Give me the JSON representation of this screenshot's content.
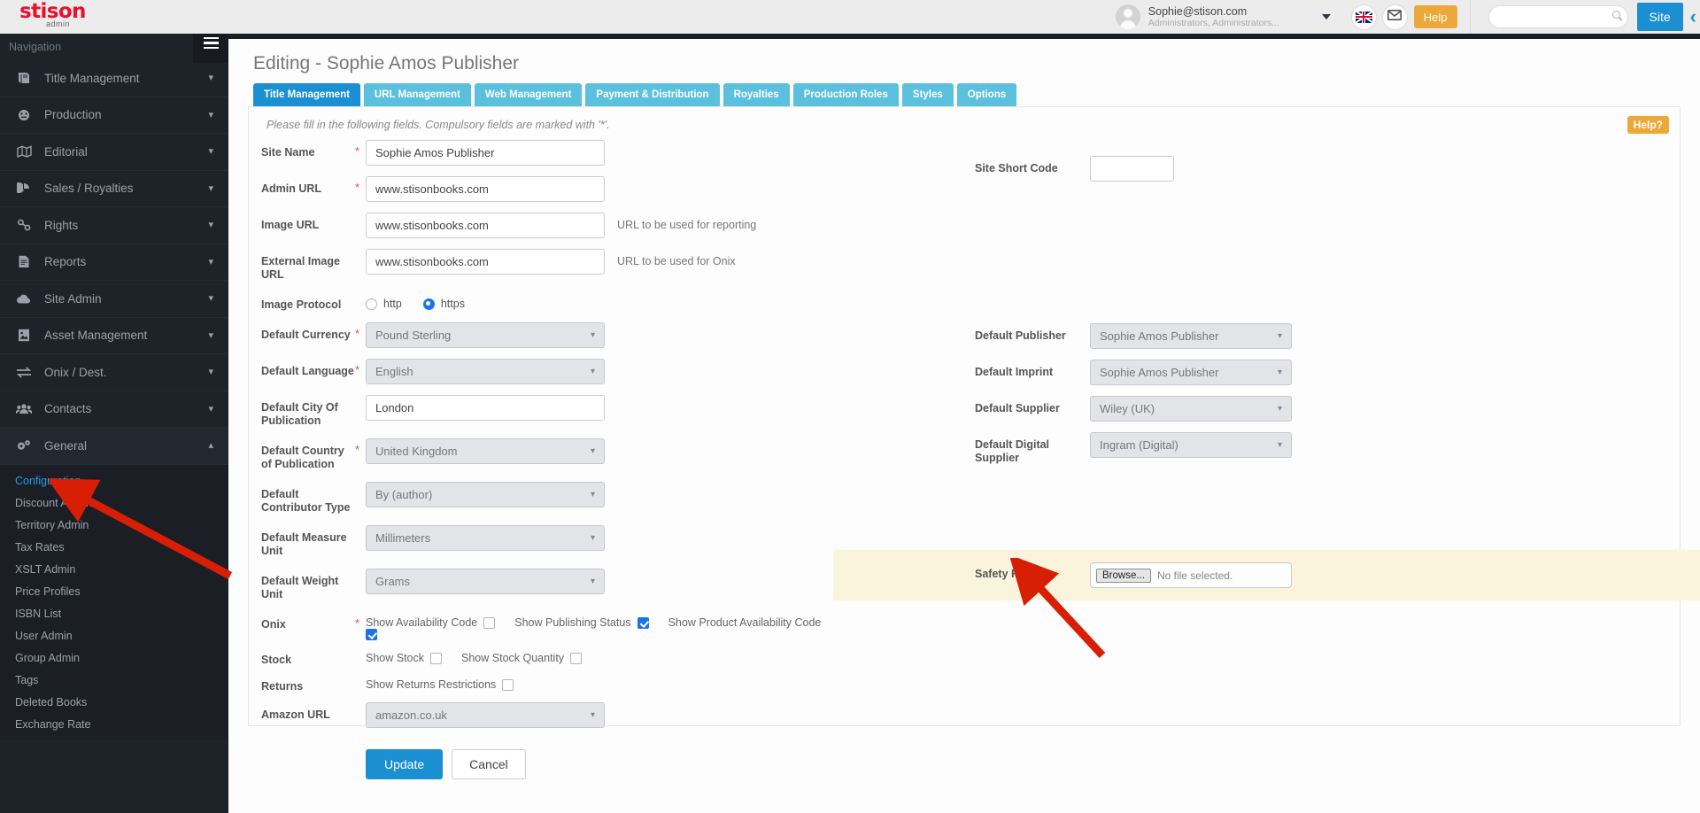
{
  "topbar": {
    "logo_main": "stison",
    "logo_sub": "admin",
    "user_email": "Sophie@stison.com",
    "user_role": "Administrators, Administrators...",
    "flag_icon": "uk-flag-icon",
    "mail_icon": "envelope-icon",
    "help_label": "Help",
    "search_value": "",
    "search_placeholder": "",
    "site_label": "Site",
    "collapse_icon": "chevron-left-icon",
    "accent_blue": "#1a8fd1",
    "accent_orange": "#eda83a",
    "logo_red": "#e8112d"
  },
  "sidebar": {
    "header_label": "Navigation",
    "burger_icon": "hamburger-icon",
    "items": [
      {
        "label": "Title Management",
        "icon": "book-icon",
        "chevron": "chevron-down-icon",
        "open": false
      },
      {
        "label": "Production",
        "icon": "gauge-icon",
        "chevron": "chevron-down-icon",
        "open": false
      },
      {
        "label": "Editorial",
        "icon": "map-icon",
        "chevron": "chevron-down-icon",
        "open": false
      },
      {
        "label": "Sales / Royalties",
        "icon": "pie-chart-icon",
        "chevron": "chevron-down-icon",
        "open": false
      },
      {
        "label": "Rights",
        "icon": "link-icon",
        "chevron": "chevron-down-icon",
        "open": false
      },
      {
        "label": "Reports",
        "icon": "document-icon",
        "chevron": "chevron-down-icon",
        "open": false
      },
      {
        "label": "Site Admin",
        "icon": "cloud-icon",
        "chevron": "chevron-down-icon",
        "open": false
      },
      {
        "label": "Asset Management",
        "icon": "image-file-icon",
        "chevron": "chevron-down-icon",
        "open": false
      },
      {
        "label": "Onix / Dest.",
        "icon": "exchange-icon",
        "chevron": "chevron-down-icon",
        "open": false
      },
      {
        "label": "Contacts",
        "icon": "users-icon",
        "chevron": "chevron-down-icon",
        "open": false
      },
      {
        "label": "General",
        "icon": "gears-icon",
        "chevron": "chevron-up-icon",
        "open": true
      }
    ],
    "sub_items": [
      {
        "label": "Configuration",
        "active": true
      },
      {
        "label": "Discount Admin",
        "active": false
      },
      {
        "label": "Territory Admin",
        "active": false
      },
      {
        "label": "Tax Rates",
        "active": false
      },
      {
        "label": "XSLT Admin",
        "active": false
      },
      {
        "label": "Price Profiles",
        "active": false
      },
      {
        "label": "ISBN List",
        "active": false
      },
      {
        "label": "User Admin",
        "active": false
      },
      {
        "label": "Group Admin",
        "active": false
      },
      {
        "label": "Tags",
        "active": false
      },
      {
        "label": "Deleted Books",
        "active": false
      },
      {
        "label": "Exchange Rate",
        "active": false
      }
    ]
  },
  "main": {
    "page_title": "Editing - Sophie Amos Publisher",
    "help_tag": "Help?",
    "hint": "Please fill in the following fields. Compulsory fields are marked with '*'.",
    "tabs": [
      {
        "label": "Title Management",
        "active": true
      },
      {
        "label": "URL Management",
        "active": false
      },
      {
        "label": "Web Management",
        "active": false
      },
      {
        "label": "Payment & Distribution",
        "active": false
      },
      {
        "label": "Royalties",
        "active": false
      },
      {
        "label": "Production Roles",
        "active": false
      },
      {
        "label": "Styles",
        "active": false
      },
      {
        "label": "Options",
        "active": false
      }
    ],
    "left_fields": {
      "site_name": {
        "label": "Site Name",
        "required": true,
        "value": "Sophie Amos Publisher"
      },
      "admin_url": {
        "label": "Admin URL",
        "required": true,
        "value": "www.stisonbooks.com"
      },
      "image_url": {
        "label": "Image URL",
        "required": false,
        "value": "www.stisonbooks.com",
        "helper": "URL to be used for reporting"
      },
      "external_image_url": {
        "label": "External Image URL",
        "required": false,
        "value": "www.stisonbooks.com",
        "helper": "URL to be used for Onix"
      },
      "image_protocol": {
        "label": "Image Protocol",
        "options": [
          {
            "label": "http",
            "selected": false
          },
          {
            "label": "https",
            "selected": true
          }
        ]
      },
      "default_currency": {
        "label": "Default Currency",
        "required": true,
        "value": "Pound Sterling"
      },
      "default_language": {
        "label": "Default Language",
        "required": true,
        "value": "English"
      },
      "default_city": {
        "label": "Default City Of Publication",
        "required": false,
        "value": "London"
      },
      "default_country": {
        "label": "Default Country of Publication",
        "required": true,
        "value": "United Kingdom"
      },
      "default_contributor_type": {
        "label": "Default Contributor Type",
        "required": false,
        "value": "By (author)"
      },
      "default_measure_unit": {
        "label": "Default Measure Unit",
        "required": false,
        "value": "Millimeters"
      },
      "default_weight_unit": {
        "label": "Default Weight Unit",
        "required": false,
        "value": "Grams"
      },
      "onix": {
        "label": "Onix",
        "required": true,
        "checks": [
          {
            "label": "Show Availability Code",
            "checked": false
          },
          {
            "label": "Show Publishing Status",
            "checked": true
          },
          {
            "label": "Show Product Availability Code",
            "checked": true
          }
        ]
      },
      "stock": {
        "label": "Stock",
        "checks": [
          {
            "label": "Show Stock",
            "checked": false
          },
          {
            "label": "Show Stock Quantity",
            "checked": false
          }
        ]
      },
      "returns": {
        "label": "Returns",
        "checks": [
          {
            "label": "Show Returns Restrictions",
            "checked": false
          }
        ]
      },
      "amazon_url": {
        "label": "Amazon URL",
        "required": false,
        "value": "amazon.co.uk"
      }
    },
    "right_fields": {
      "site_short_code": {
        "label": "Site Short Code",
        "value": ""
      },
      "default_publisher": {
        "label": "Default Publisher",
        "value": "Sophie Amos Publisher"
      },
      "default_imprint": {
        "label": "Default Imprint",
        "value": "Sophie Amos Publisher"
      },
      "default_supplier": {
        "label": "Default Supplier",
        "value": "Wiley (UK)"
      },
      "default_digital_supplier": {
        "label": "Default Digital Supplier",
        "value": "Ingram (Digital)"
      },
      "safety_file": {
        "label": "Safety File",
        "browse_label": "Browse...",
        "status": "No file selected."
      }
    },
    "buttons": {
      "update": "Update",
      "cancel": "Cancel"
    }
  },
  "annotations": {
    "arrow_color": "#d81e05"
  }
}
